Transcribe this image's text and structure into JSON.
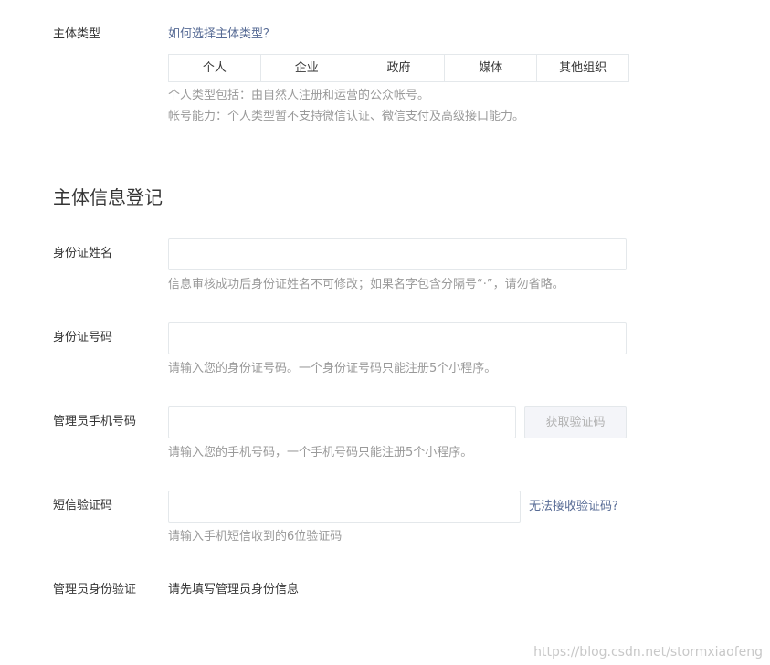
{
  "subject_type": {
    "label": "主体类型",
    "help_link": "如何选择主体类型？",
    "options": [
      "个人",
      "企业",
      "政府",
      "媒体",
      "其他组织"
    ],
    "selected": "个人",
    "tip_line1": "个人类型包括：由自然人注册和运营的公众帐号。",
    "tip_line2": "帐号能力：个人类型暂不支持微信认证、微信支付及高级接口能力。"
  },
  "section": {
    "title": "主体信息登记"
  },
  "id_name": {
    "label": "身份证姓名",
    "value": "",
    "tip": "信息审核成功后身份证姓名不可修改；如果名字包含分隔号“·”，请勿省略。"
  },
  "id_number": {
    "label": "身份证号码",
    "value": "",
    "tip": "请输入您的身份证号码。一个身份证号码只能注册5个小程序。"
  },
  "phone": {
    "label": "管理员手机号码",
    "value": "",
    "button": "获取验证码",
    "tip": "请输入您的手机号码，一个手机号码只能注册5个小程序。"
  },
  "sms_code": {
    "label": "短信验证码",
    "value": "",
    "link": "无法接收验证码?",
    "tip": "请输入手机短信收到的6位验证码"
  },
  "admin_verify": {
    "label": "管理员身份验证",
    "value": "请先填写管理员身份信息"
  },
  "watermark": "https://blog.csdn.net/stormxiaofeng",
  "colors": {
    "link": "#576b95",
    "border": "#e4e8eb",
    "tip": "#9a9a9a",
    "text": "#353535"
  }
}
